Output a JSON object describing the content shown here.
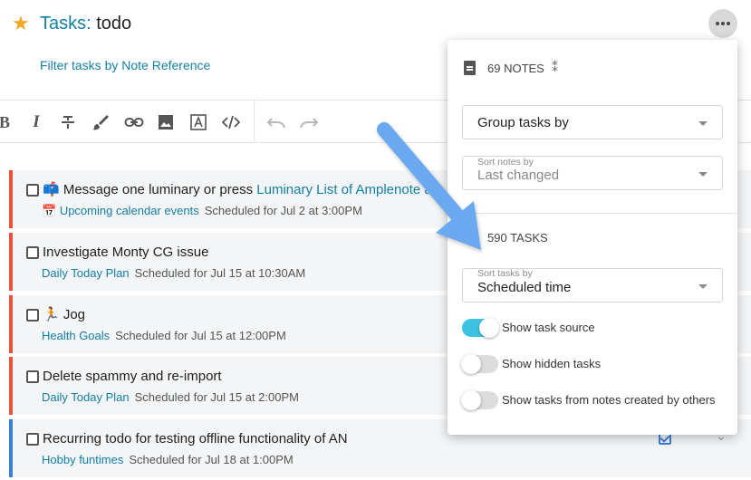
{
  "header": {
    "star_icon": "star-icon",
    "title_tag": "Tasks:",
    "title_name": " todo",
    "filter_link": "Filter tasks by Note Reference",
    "more_icon": "more-horizontal-icon"
  },
  "toolbar": {
    "items": [
      "bold-icon",
      "italic-icon",
      "strikethrough-icon",
      "brush-icon",
      "link-icon",
      "image-icon",
      "text-field-icon",
      "code-icon",
      "undo-icon",
      "redo-icon"
    ]
  },
  "tasks": [
    {
      "prefix": "📫 Message one luminary or press ",
      "link": "Luminary List of Amplenote a",
      "link_tail": "",
      "source_emoji": "📅 ",
      "source": "Upcoming calendar events",
      "scheduled": "Scheduled for Jul 2 at 3:00PM",
      "accent": "#e8533f"
    },
    {
      "prefix": "Investigate Monty CG issue",
      "source": "Daily Today Plan",
      "scheduled": "Scheduled for Jul 15 at 10:30AM",
      "accent": "#e8533f"
    },
    {
      "prefix": "🏃 Jog",
      "source": "Health Goals",
      "scheduled": "Scheduled for Jul 15 at 12:00PM",
      "accent": "#e8533f"
    },
    {
      "prefix": "Delete spammy and re-import",
      "source": "Daily Today Plan",
      "scheduled": "Scheduled for Jul 15 at 2:00PM",
      "accent": "#e8533f"
    },
    {
      "prefix": "Recurring todo for testing offline functionality of AN",
      "source": "Hobby funtimes",
      "scheduled": "Scheduled for Jul 18 at 1:00PM",
      "accent": "#3c7fd6"
    }
  ],
  "popover": {
    "notes_count": "69 NOTES",
    "group_select": {
      "value": "Group tasks by"
    },
    "sort_notes_select": {
      "label": "Sort notes by",
      "value": "Last changed"
    },
    "tasks_count": "590 TASKS",
    "sort_tasks_select": {
      "label": "Sort tasks by",
      "value": "Scheduled time"
    },
    "toggles": [
      {
        "label": "Show task source",
        "on": true
      },
      {
        "label": "Show hidden tasks",
        "on": false
      },
      {
        "label": "Show tasks from notes created by others",
        "on": false
      }
    ]
  },
  "colors": {
    "accent_teal": "#137fa3",
    "toggle_on": "#3cc3e1",
    "arrow": "#6aa8f0",
    "task_border_red": "#e8533f",
    "task_border_blue": "#3c7fd6"
  }
}
